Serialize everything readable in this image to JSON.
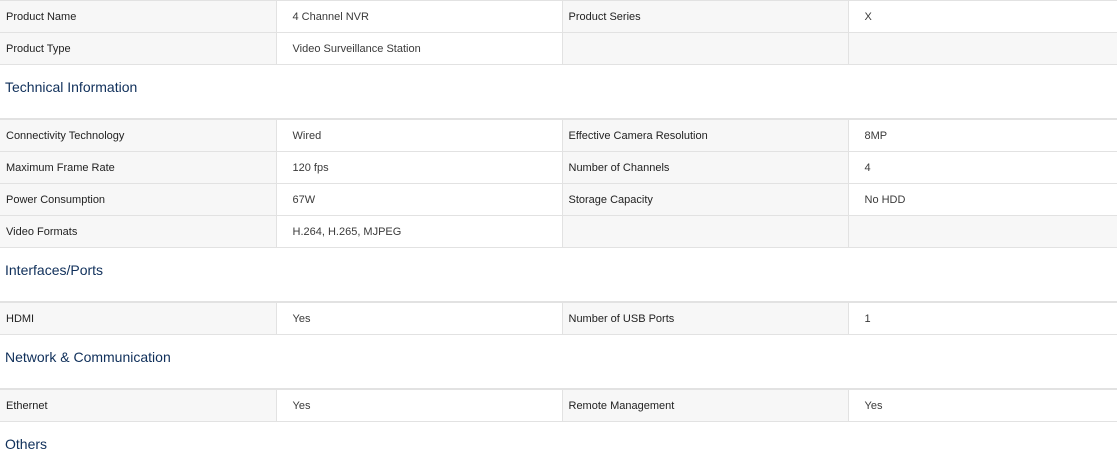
{
  "top_rows": [
    [
      "Product Name",
      "4 Channel NVR",
      "Product Series",
      "X"
    ],
    [
      "Product Type",
      "Video Surveillance Station",
      "",
      ""
    ]
  ],
  "sections": [
    {
      "title": "Technical Information",
      "rows": [
        [
          "Connectivity Technology",
          "Wired",
          "Effective Camera Resolution",
          "8MP"
        ],
        [
          "Maximum Frame Rate",
          "120 fps",
          "Number of Channels",
          "4"
        ],
        [
          "Power Consumption",
          "67W",
          "Storage Capacity",
          "No HDD"
        ],
        [
          "Video Formats",
          "H.264, H.265, MJPEG",
          "",
          ""
        ]
      ]
    },
    {
      "title": "Interfaces/Ports",
      "rows": [
        [
          "HDMI",
          "Yes",
          "Number of USB Ports",
          "1"
        ]
      ]
    },
    {
      "title": "Network & Communication",
      "rows": [
        [
          "Ethernet",
          "Yes",
          "Remote Management",
          "Yes"
        ]
      ]
    }
  ],
  "last_heading": "Others"
}
